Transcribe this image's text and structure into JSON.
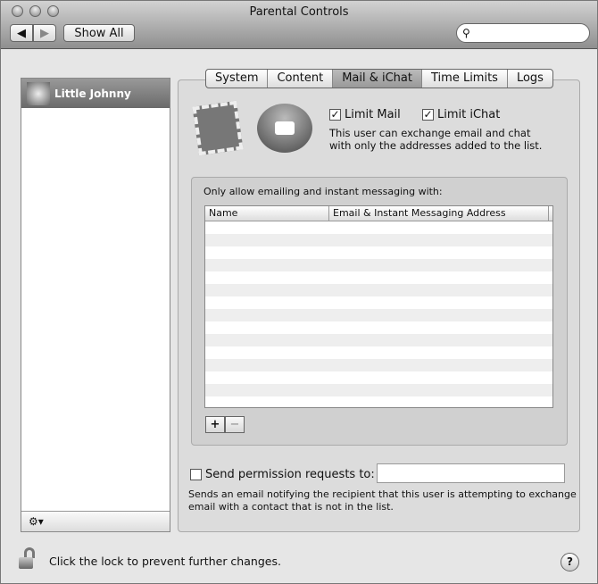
{
  "window": {
    "title": "Parental Controls"
  },
  "toolbar": {
    "show_all": "Show All",
    "search_placeholder": ""
  },
  "sidebar": {
    "users": [
      {
        "name": "Little Johnny"
      }
    ],
    "gear": "⚙▾"
  },
  "tabs": [
    {
      "label": "System"
    },
    {
      "label": "Content"
    },
    {
      "label": "Mail & iChat",
      "selected": true
    },
    {
      "label": "Time Limits"
    },
    {
      "label": "Logs"
    }
  ],
  "mail": {
    "limit_mail": "Limit Mail",
    "limit_ichat": "Limit iChat",
    "limit_mail_checked": true,
    "limit_ichat_checked": true,
    "description_1": "This user can exchange email and chat",
    "description_2": "with only the addresses added to the list."
  },
  "list": {
    "heading": "Only allow emailing and instant messaging with:",
    "columns": [
      "Name",
      "Email & Instant Messaging Address"
    ],
    "rows": [],
    "add": "+",
    "remove": "−"
  },
  "permission": {
    "label": "Send permission requests to:",
    "checked": false,
    "value": "",
    "note_1": "Sends an email notifying the recipient that this user is attempting to exchange",
    "note_2": "email with a contact that is not in the list."
  },
  "footer": {
    "lock_text": "Click the lock to prevent further changes.",
    "help": "?"
  }
}
